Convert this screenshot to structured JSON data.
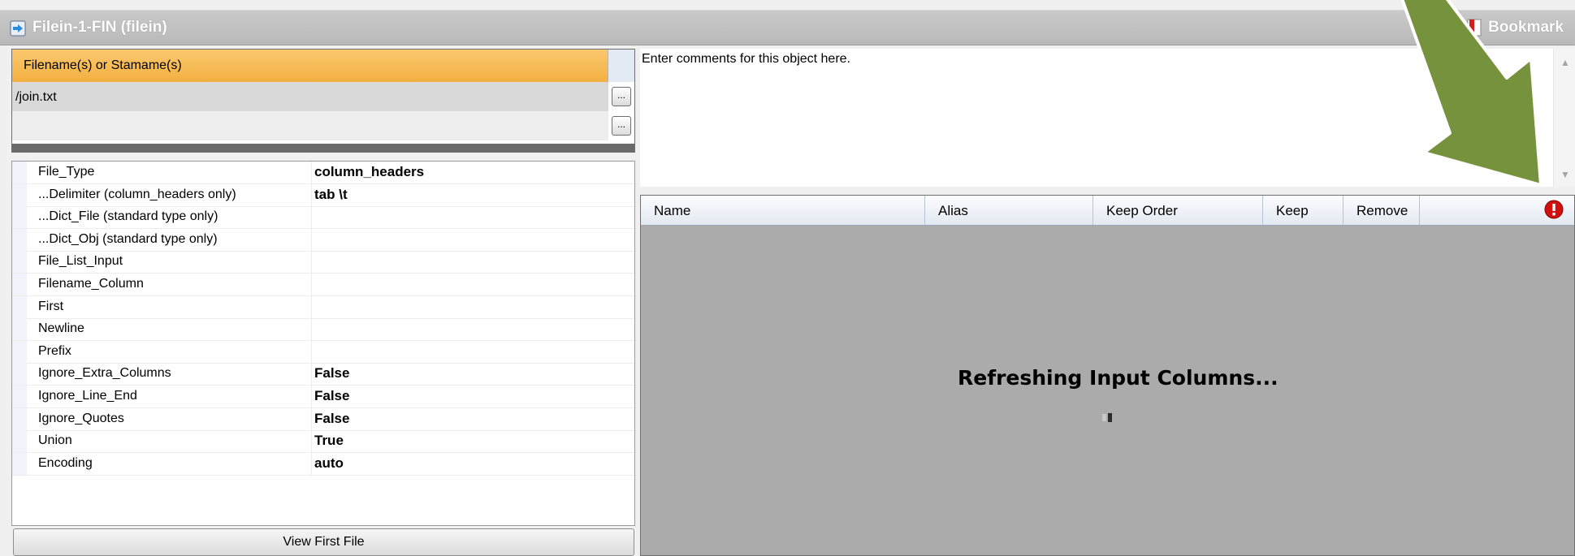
{
  "window": {
    "title": "Filein-1-FIN (filein)",
    "bookmark_label": "Bookmark"
  },
  "filenames": {
    "header": "Filename(s) or Stamame(s)",
    "rows": [
      "/join.txt",
      ""
    ]
  },
  "properties": [
    {
      "name": "File_Type",
      "value": "column_headers"
    },
    {
      "name": "...Delimiter (column_headers only)",
      "value": "tab \\t"
    },
    {
      "name": "...Dict_File (standard type only)",
      "value": ""
    },
    {
      "name": "...Dict_Obj (standard type only)",
      "value": ""
    },
    {
      "name": "File_List_Input",
      "value": ""
    },
    {
      "name": "Filename_Column",
      "value": ""
    },
    {
      "name": "First",
      "value": ""
    },
    {
      "name": "Newline",
      "value": ""
    },
    {
      "name": "Prefix",
      "value": ""
    },
    {
      "name": "Ignore_Extra_Columns",
      "value": "False"
    },
    {
      "name": "Ignore_Line_End",
      "value": "False"
    },
    {
      "name": "Ignore_Quotes",
      "value": "False"
    },
    {
      "name": "Union",
      "value": "True"
    },
    {
      "name": "Encoding",
      "value": "auto"
    }
  ],
  "view_first_file_label": "View First File",
  "comments": {
    "text": "Enter comments for this object here."
  },
  "columns_grid": {
    "headers": [
      "Name",
      "Alias",
      "Keep Order",
      "Keep",
      "Remove"
    ],
    "status": "Refreshing Input Columns..."
  },
  "colors": {
    "header_orange": "#f3b040",
    "arrow_green": "#77923c",
    "error_red": "#d01010"
  },
  "icons": {
    "title": "filein-arrow-icon",
    "bookmark": "bookmark-icon",
    "error": "error-icon"
  }
}
